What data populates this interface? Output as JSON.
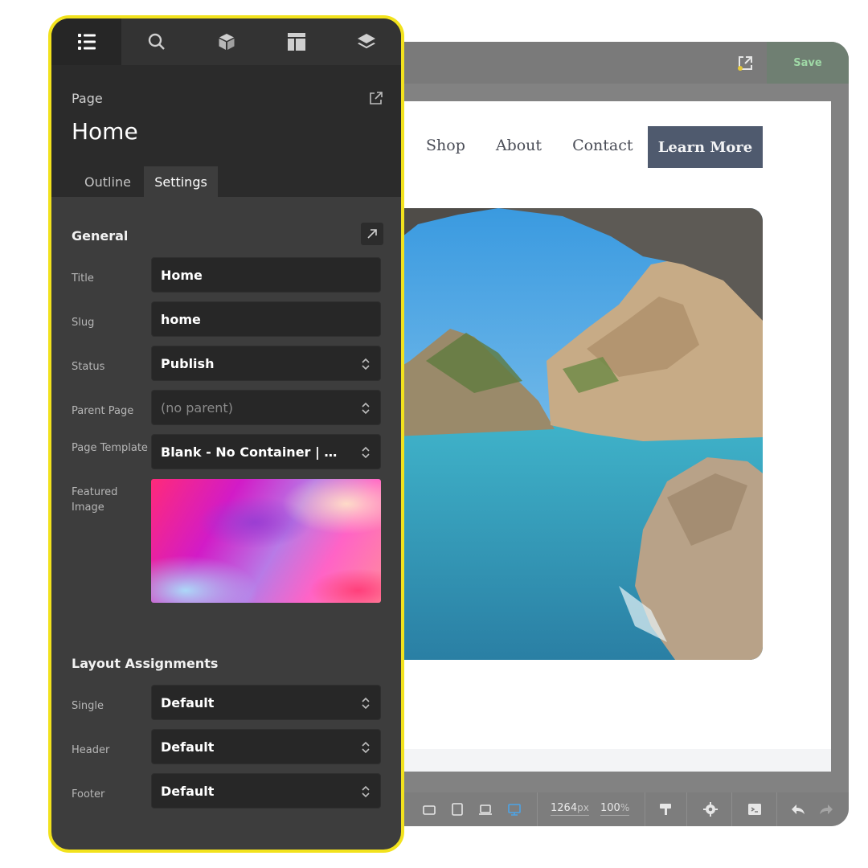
{
  "builder": {
    "save_label": "Save",
    "nav": [
      "Shop",
      "About",
      "Contact"
    ],
    "cta_label": "Learn More",
    "width_value": "1264",
    "width_unit": "px",
    "zoom_value": "100",
    "zoom_unit": "%"
  },
  "panel": {
    "tabs": [
      "outline-list",
      "search",
      "cube",
      "template",
      "layers"
    ],
    "header_label": "Page",
    "page_title": "Home",
    "subtabs": [
      "Outline",
      "Settings"
    ],
    "active_subtab": "Settings",
    "general": {
      "title": "General",
      "title_label": "Title",
      "title_value": "Home",
      "slug_label": "Slug",
      "slug_value": "home",
      "status_label": "Status",
      "status_value": "Publish",
      "parent_label": "Parent Page",
      "parent_value": "(no parent)",
      "template_label": "Page Template",
      "template_value": "Blank - No Container | Header and Footer",
      "featured_label": "Featured Image"
    },
    "layout": {
      "title": "Layout Assignments",
      "single_label": "Single",
      "single_value": "Default",
      "header_label": "Header",
      "header_value": "Default",
      "footer_label": "Footer",
      "footer_value": "Default"
    }
  },
  "colors": {
    "highlight": "#f2e21d",
    "panel_bg": "#3d3d3d",
    "cta_bg": "#4f5a6e"
  }
}
